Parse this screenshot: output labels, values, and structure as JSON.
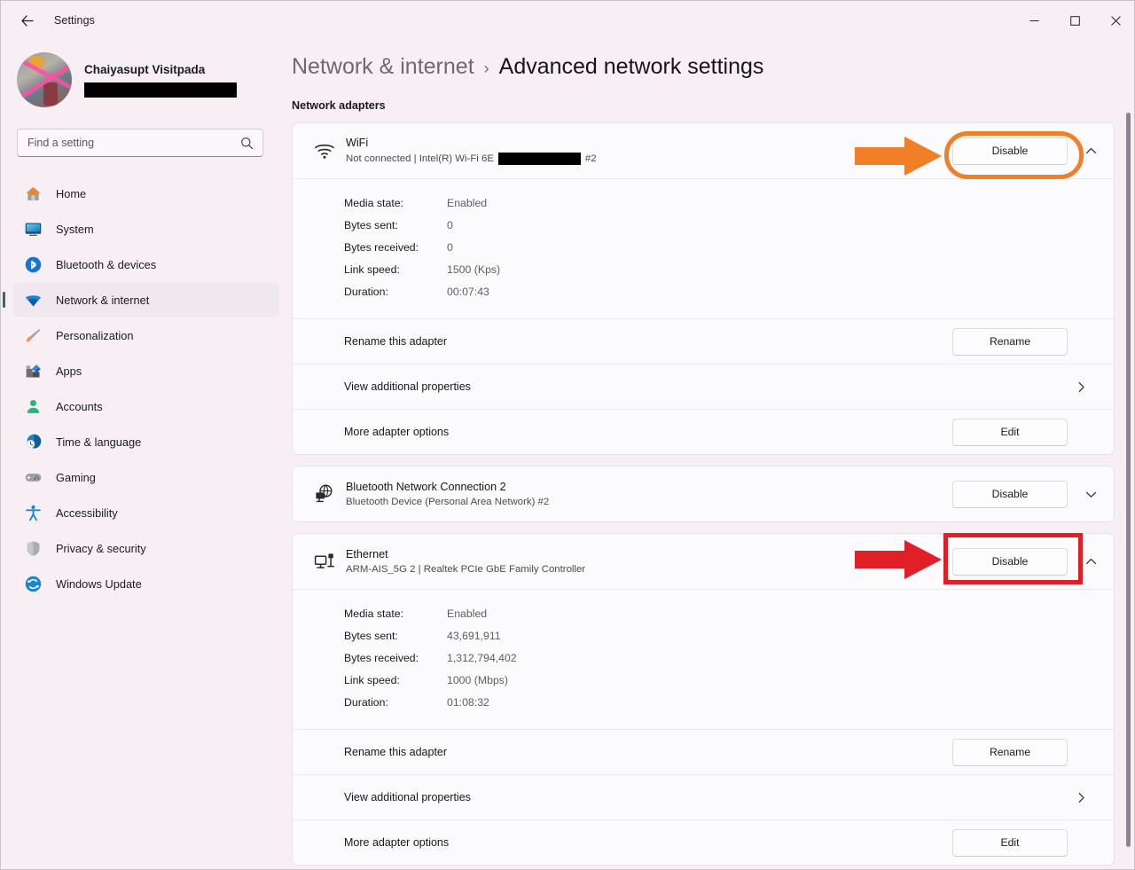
{
  "window": {
    "title": "Settings",
    "back_icon": "arrow-left-icon",
    "controls": {
      "minimize": "─",
      "maximize": "□",
      "close": "✕"
    }
  },
  "sidebar": {
    "account": {
      "name": "Chaiyasupt Visitpada",
      "email_redacted": true
    },
    "search": {
      "placeholder": "Find a setting",
      "value": "",
      "icon": "search-icon"
    },
    "items": [
      {
        "label": "Home",
        "icon": "home-icon",
        "selected": false
      },
      {
        "label": "System",
        "icon": "system-icon",
        "selected": false
      },
      {
        "label": "Bluetooth & devices",
        "icon": "bluetooth-icon",
        "selected": false
      },
      {
        "label": "Network & internet",
        "icon": "wifi-icon",
        "selected": true
      },
      {
        "label": "Personalization",
        "icon": "brush-icon",
        "selected": false
      },
      {
        "label": "Apps",
        "icon": "apps-icon",
        "selected": false
      },
      {
        "label": "Accounts",
        "icon": "person-icon",
        "selected": false
      },
      {
        "label": "Time & language",
        "icon": "clock-globe-icon",
        "selected": false
      },
      {
        "label": "Gaming",
        "icon": "gamepad-icon",
        "selected": false
      },
      {
        "label": "Accessibility",
        "icon": "accessibility-icon",
        "selected": false
      },
      {
        "label": "Privacy & security",
        "icon": "shield-icon",
        "selected": false
      },
      {
        "label": "Windows Update",
        "icon": "update-icon",
        "selected": false
      }
    ]
  },
  "main": {
    "breadcrumb": {
      "parent": "Network & internet",
      "separator": "›",
      "current": "Advanced network settings"
    },
    "section_title": "Network adapters",
    "adapters": [
      {
        "name": "WiFi",
        "subtitle_prefix": "Not connected | Intel(R) Wi-Fi 6E",
        "subtitle_suffix": "#2",
        "icon": "wifi-signal-icon",
        "action_label": "Disable",
        "expanded": true,
        "chevron": "chevron-up-icon",
        "details": [
          {
            "key": "Media state:",
            "value": "Enabled"
          },
          {
            "key": "Bytes sent:",
            "value": "0"
          },
          {
            "key": "Bytes received:",
            "value": "0"
          },
          {
            "key": "Link speed:",
            "value": "1500 (Kps)"
          },
          {
            "key": "Duration:",
            "value": "00:07:43"
          }
        ],
        "sub_rows": [
          {
            "label": "Rename this adapter",
            "control": "button",
            "button_label": "Rename"
          },
          {
            "label": "View additional properties",
            "control": "chevron",
            "chevron": "chevron-right-icon"
          },
          {
            "label": "More adapter options",
            "control": "button",
            "button_label": "Edit"
          }
        ]
      },
      {
        "name": "Bluetooth Network Connection 2",
        "subtitle_prefix": "Bluetooth Device (Personal Area Network) #2",
        "subtitle_suffix": "",
        "icon": "bluetooth-network-icon",
        "action_label": "Disable",
        "expanded": false,
        "chevron": "chevron-down-icon",
        "details": [],
        "sub_rows": []
      },
      {
        "name": "Ethernet",
        "subtitle_prefix": "ARM-AIS_5G 2 | Realtek PCIe GbE Family Controller",
        "subtitle_suffix": "",
        "icon": "ethernet-icon",
        "action_label": "Disable",
        "expanded": true,
        "chevron": "chevron-up-icon",
        "details": [
          {
            "key": "Media state:",
            "value": "Enabled"
          },
          {
            "key": "Bytes sent:",
            "value": "43,691,911"
          },
          {
            "key": "Bytes received:",
            "value": "1,312,794,402"
          },
          {
            "key": "Link speed:",
            "value": "1000 (Mbps)"
          },
          {
            "key": "Duration:",
            "value": "01:08:32"
          }
        ],
        "sub_rows": [
          {
            "label": "Rename this adapter",
            "control": "button",
            "button_label": "Rename"
          },
          {
            "label": "View additional properties",
            "control": "chevron",
            "chevron": "chevron-right-icon"
          },
          {
            "label": "More adapter options",
            "control": "button",
            "button_label": "Edit"
          }
        ]
      }
    ]
  },
  "annotations": {
    "orange": {
      "color": "#f07f28",
      "target": "WiFi Disable button",
      "shape": "rounded-rect-outline-with-arrow"
    },
    "red": {
      "color": "#e01f26",
      "target": "Ethernet Disable button",
      "shape": "rect-outline-with-arrow"
    }
  },
  "colors": {
    "window_background": "#f7eff4",
    "card_background": "#fbfafc",
    "accent_selected": "#2d6b63",
    "text_primary": "#171717",
    "text_secondary": "#5f5d62"
  }
}
